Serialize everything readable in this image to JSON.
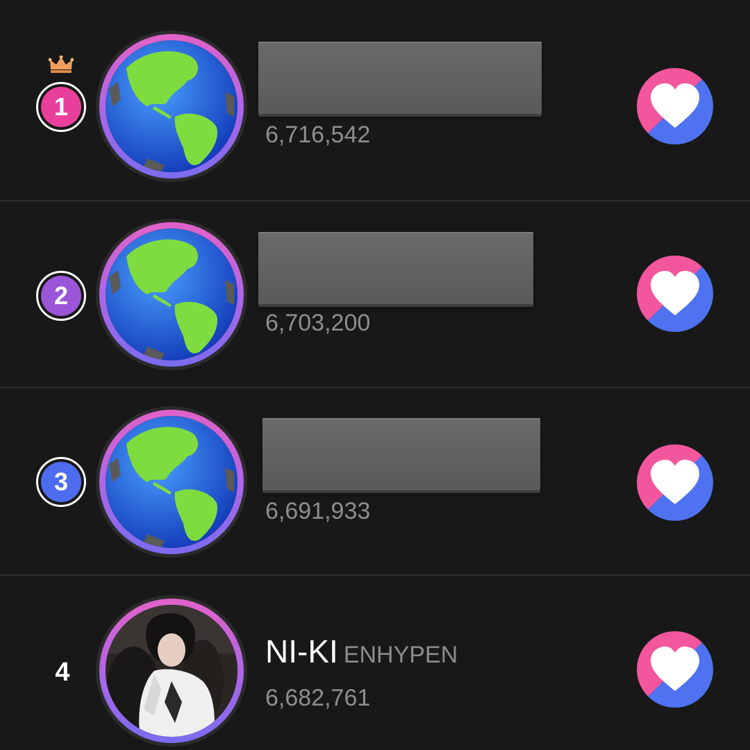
{
  "colors": {
    "rank1": "#e93f9c",
    "rank2": "#9a55d8",
    "rank3": "#4e6cf0",
    "vote_pink": "#f2569d",
    "vote_blue": "#4f72f0",
    "crown": "#f0a05a"
  },
  "ranking": [
    {
      "rank": "1",
      "votes": "6,716,542",
      "avatar": "globe-icon",
      "crown": "crown-icon"
    },
    {
      "rank": "2",
      "votes": "6,703,200",
      "avatar": "globe-icon"
    },
    {
      "rank": "3",
      "votes": "6,691,933",
      "avatar": "globe-icon"
    },
    {
      "rank": "4",
      "votes": "6,682,761",
      "avatar": "artist-photo",
      "name": "NI-KI",
      "group": "ENHYPEN"
    }
  ],
  "vote_button_icon": "heart-icon"
}
